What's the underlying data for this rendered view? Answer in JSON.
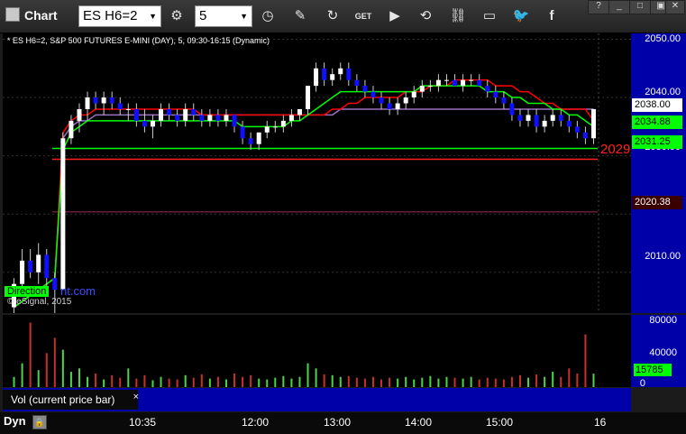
{
  "window": {
    "title": "Chart"
  },
  "toolbar": {
    "symbol": "ES H6=2",
    "interval": "5",
    "icons": [
      "settings-icon",
      "clock-icon",
      "pencil-icon",
      "refresh-icon",
      "quote-icon",
      "play-icon",
      "link-icon",
      "chat-icon",
      "twitter-icon",
      "facebook-icon"
    ]
  },
  "chart": {
    "header": "* ES H6=2, S&P 500 FUTURES E-MINI (DAY), 5, 09:30-16:15 (Dynamic)",
    "watermark": "© eSignal, 2015",
    "direction_label": "Direction",
    "direction_url": "nt.com",
    "red_level_label": "2029",
    "price_axis": [
      "2050.00",
      "2040.00",
      "2030.00",
      "2010.00"
    ],
    "price_flags": [
      {
        "value": "2038.00",
        "bg": "#ffffff"
      },
      {
        "value": "2034.88",
        "bg": "#00ff00"
      },
      {
        "value": "2031.25",
        "bg": "#00ff00"
      },
      {
        "value": "2020.38",
        "bg": "#3a0000",
        "color": "#ffffff"
      }
    ],
    "volume_axis": [
      "80000",
      "40000",
      "0"
    ],
    "volume_flag": "15785",
    "study_label": "Vol (current price bar)",
    "study_close": "×",
    "time_axis": [
      "10:35",
      "12:00",
      "13:00",
      "14:00",
      "15:00",
      "16"
    ],
    "footer_mode": "Dyn",
    "colors": {
      "up": "#ffffff",
      "down": "#1010ff",
      "ma_fast": "#00ff00",
      "ma_slow": "#ff0000",
      "ma_purple": "#9a70c0",
      "support": "#ff2020",
      "pane_bg": "#000000",
      "axis_bg": "#0000a8"
    }
  },
  "chart_data": {
    "type": "candlestick",
    "ylim": [
      2003,
      2051
    ],
    "candles": [
      [
        2004,
        2009,
        2003,
        2008
      ],
      [
        2008,
        2014,
        2006,
        2012
      ],
      [
        2012,
        2014,
        2009,
        2010
      ],
      [
        2010,
        2015,
        2008,
        2013
      ],
      [
        2013,
        2014,
        2007,
        2009
      ],
      [
        2009,
        2010,
        2003,
        2007
      ],
      [
        2007,
        2034,
        2007,
        2033
      ],
      [
        2033,
        2037,
        2032,
        2036
      ],
      [
        2036,
        2039,
        2034,
        2038
      ],
      [
        2038,
        2041,
        2036,
        2040
      ],
      [
        2040,
        2041,
        2038,
        2039
      ],
      [
        2039,
        2041,
        2037,
        2040
      ],
      [
        2040,
        2041,
        2038,
        2039
      ],
      [
        2039,
        2040,
        2037,
        2038
      ],
      [
        2038,
        2039,
        2036,
        2038
      ],
      [
        2038,
        2039,
        2035,
        2036
      ],
      [
        2036,
        2038,
        2034,
        2035
      ],
      [
        2035,
        2037,
        2033,
        2036
      ],
      [
        2036,
        2039,
        2035,
        2038
      ],
      [
        2038,
        2039,
        2036,
        2037
      ],
      [
        2037,
        2038,
        2035,
        2036
      ],
      [
        2036,
        2039,
        2035,
        2038
      ],
      [
        2038,
        2039,
        2036,
        2037
      ],
      [
        2037,
        2038,
        2035,
        2036
      ],
      [
        2036,
        2038,
        2035,
        2037
      ],
      [
        2037,
        2038,
        2035,
        2036
      ],
      [
        2036,
        2038,
        2035,
        2037
      ],
      [
        2037,
        2037,
        2034,
        2035
      ],
      [
        2035,
        2036,
        2032,
        2033
      ],
      [
        2033,
        2034,
        2031,
        2032
      ],
      [
        2032,
        2034,
        2031,
        2034
      ],
      [
        2034,
        2036,
        2033,
        2035
      ],
      [
        2035,
        2036,
        2034,
        2035
      ],
      [
        2035,
        2037,
        2034,
        2036
      ],
      [
        2036,
        2038,
        2035,
        2037
      ],
      [
        2037,
        2038,
        2036,
        2038
      ],
      [
        2038,
        2042,
        2037,
        2042
      ],
      [
        2042,
        2046,
        2041,
        2045
      ],
      [
        2045,
        2046,
        2042,
        2043
      ],
      [
        2043,
        2045,
        2042,
        2044
      ],
      [
        2044,
        2046,
        2043,
        2045
      ],
      [
        2045,
        2046,
        2042,
        2043
      ],
      [
        2043,
        2044,
        2041,
        2042
      ],
      [
        2042,
        2043,
        2040,
        2041
      ],
      [
        2041,
        2042,
        2039,
        2040
      ],
      [
        2040,
        2041,
        2038,
        2039
      ],
      [
        2039,
        2040,
        2037,
        2038
      ],
      [
        2038,
        2040,
        2037,
        2039
      ],
      [
        2039,
        2041,
        2038,
        2040
      ],
      [
        2040,
        2042,
        2039,
        2041
      ],
      [
        2041,
        2043,
        2040,
        2042
      ],
      [
        2042,
        2043,
        2041,
        2042
      ],
      [
        2042,
        2044,
        2041,
        2043
      ],
      [
        2043,
        2044,
        2042,
        2043
      ],
      [
        2043,
        2044,
        2042,
        2042
      ],
      [
        2042,
        2044,
        2041,
        2043
      ],
      [
        2043,
        2044,
        2042,
        2043
      ],
      [
        2043,
        2044,
        2042,
        2042
      ],
      [
        2042,
        2043,
        2040,
        2041
      ],
      [
        2041,
        2042,
        2039,
        2040
      ],
      [
        2040,
        2041,
        2038,
        2039
      ],
      [
        2039,
        2040,
        2036,
        2037
      ],
      [
        2037,
        2038,
        2035,
        2036
      ],
      [
        2036,
        2038,
        2035,
        2037
      ],
      [
        2037,
        2038,
        2034,
        2035
      ],
      [
        2035,
        2037,
        2034,
        2036
      ],
      [
        2036,
        2038,
        2035,
        2037
      ],
      [
        2037,
        2038,
        2035,
        2036
      ],
      [
        2036,
        2037,
        2034,
        2035
      ],
      [
        2035,
        2036,
        2033,
        2034
      ],
      [
        2034,
        2035,
        2032,
        2033
      ],
      [
        2033,
        2038,
        2032,
        2038
      ]
    ],
    "ma_fast": [
      2004,
      2005,
      2006,
      2007,
      2008,
      2009,
      2031,
      2034,
      2035,
      2036,
      2036,
      2036,
      2036,
      2036,
      2036,
      2036,
      2036,
      2036,
      2036,
      2036,
      2036,
      2036,
      2036,
      2036,
      2036,
      2036,
      2036,
      2036,
      2035,
      2035,
      2035,
      2035,
      2035,
      2035,
      2036,
      2036,
      2037,
      2038,
      2039,
      2040,
      2041,
      2041,
      2041,
      2041,
      2041,
      2041,
      2041,
      2041,
      2041,
      2041,
      2042,
      2042,
      2042,
      2042,
      2042,
      2042,
      2042,
      2042,
      2041,
      2041,
      2041,
      2040,
      2040,
      2039,
      2039,
      2039,
      2038,
      2038,
      2037,
      2037,
      2036,
      2035
    ],
    "ma_slow": [
      2004,
      2005,
      2006,
      2007,
      2008,
      2009,
      2034,
      2036,
      2037,
      2037,
      2038,
      2038,
      2038,
      2038,
      2038,
      2038,
      2038,
      2038,
      2038,
      2038,
      2038,
      2038,
      2038,
      2037,
      2037,
      2037,
      2037,
      2037,
      2037,
      2037,
      2037,
      2037,
      2037,
      2037,
      2037,
      2037,
      2037,
      2037,
      2037,
      2038,
      2038,
      2039,
      2039,
      2040,
      2040,
      2040,
      2040,
      2040,
      2041,
      2041,
      2041,
      2042,
      2042,
      2042,
      2043,
      2043,
      2043,
      2043,
      2043,
      2042,
      2042,
      2042,
      2041,
      2041,
      2040,
      2039,
      2039,
      2038,
      2038,
      2038,
      2038,
      2036
    ],
    "ma_purple": [
      2004,
      2005,
      2006,
      2007,
      2008,
      2009,
      2033,
      2035,
      2036,
      2036,
      2037,
      2037,
      2037,
      2037,
      2037,
      2037,
      2037,
      2037,
      2037,
      2037,
      2037,
      2037,
      2037,
      2037,
      2037,
      2037,
      2037,
      2037,
      2037,
      2037,
      2037,
      2037,
      2037,
      2037,
      2037,
      2037,
      2037,
      2037,
      2037,
      2037,
      2038,
      2038,
      2038,
      2038,
      2038,
      2038,
      2038,
      2038,
      2038,
      2038,
      2038,
      2038,
      2038,
      2038,
      2038,
      2038,
      2038,
      2038,
      2038,
      2038,
      2038,
      2038,
      2038,
      2038,
      2038,
      2038,
      2038,
      2038,
      2038,
      2038,
      2038,
      2038
    ],
    "horizontal_levels": [
      {
        "value": 2031.25,
        "color": "#00ff00"
      },
      {
        "value": 2029.4,
        "color": "#ff2020"
      },
      {
        "value": 2020.38,
        "color": "#6a1a3a"
      }
    ],
    "volume_ylim": [
      0,
      85000
    ],
    "volume": [
      12000,
      28000,
      76000,
      20000,
      40000,
      58000,
      44000,
      18000,
      22000,
      12000,
      16000,
      9000,
      14000,
      11000,
      22000,
      10000,
      14000,
      8000,
      12000,
      10000,
      9000,
      14000,
      11000,
      15000,
      10000,
      12000,
      9000,
      16000,
      12000,
      14000,
      10000,
      9000,
      11000,
      13000,
      10000,
      12000,
      28000,
      22000,
      15000,
      14000,
      12000,
      13000,
      11000,
      10000,
      12000,
      9000,
      11000,
      10000,
      12000,
      9000,
      11000,
      13000,
      10000,
      12000,
      11000,
      10000,
      12000,
      9000,
      11000,
      10000,
      9000,
      12000,
      14000,
      11000,
      15000,
      12000,
      18000,
      12000,
      22000,
      16000,
      62000,
      15785
    ]
  }
}
